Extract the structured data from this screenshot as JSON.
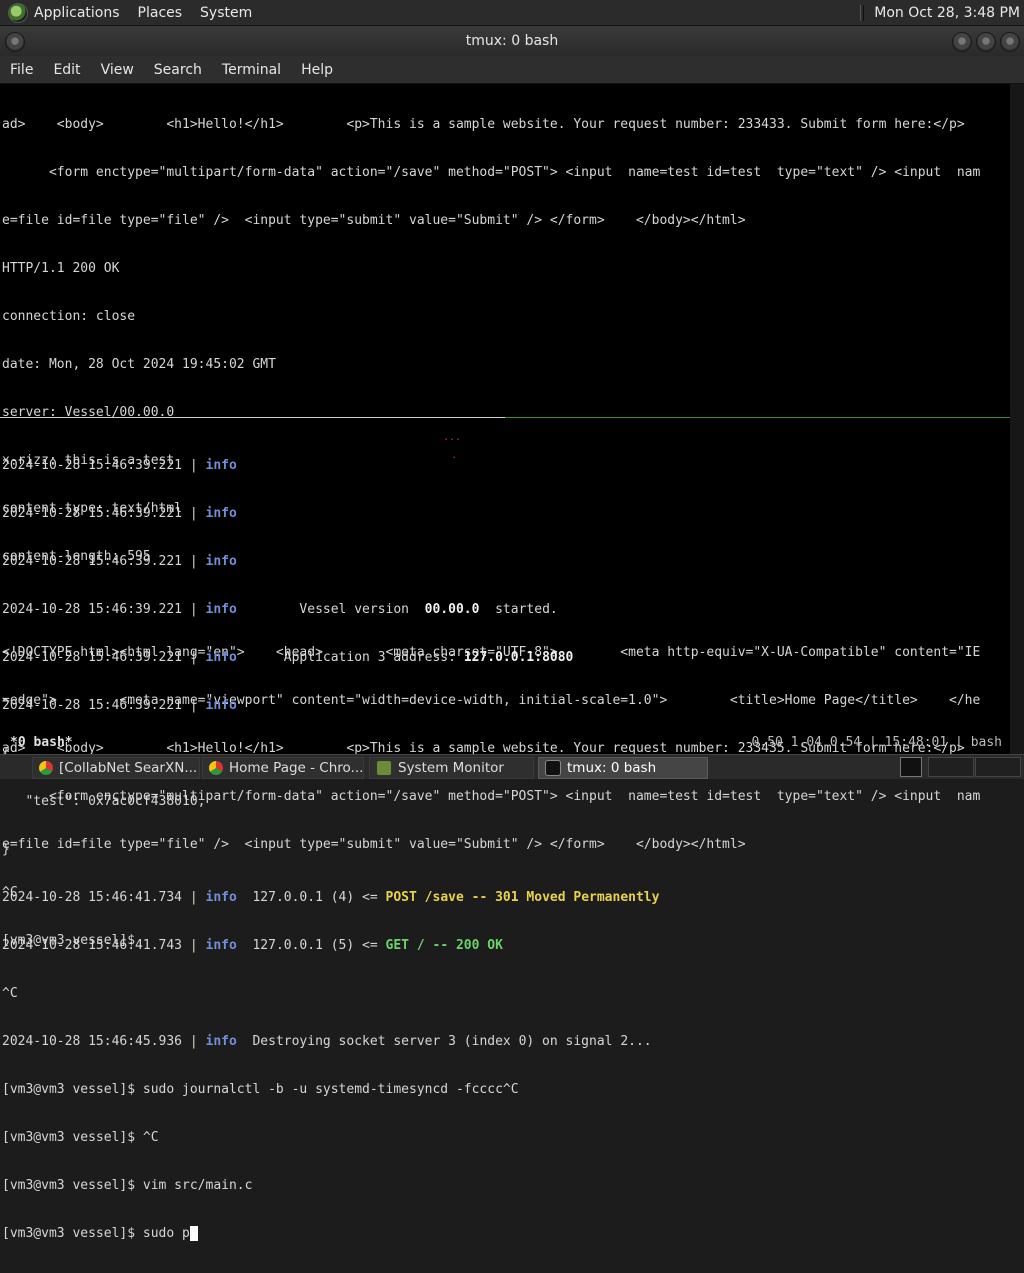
{
  "top_panel": {
    "menus": [
      "Applications",
      "Places",
      "System"
    ],
    "clock": "Mon Oct 28,  3:48 PM"
  },
  "window": {
    "title": "tmux: 0 bash"
  },
  "menubar": [
    "File",
    "Edit",
    "View",
    "Search",
    "Terminal",
    "Help"
  ],
  "terminal": {
    "top_pane": [
      "ad>    <body>        <h1>Hello!</h1>        <p>This is a sample website. Your request number: 233433. Submit form here:</p>",
      "      <form enctype=\"multipart/form-data\" action=\"/save\" method=\"POST\"> <input  name=test id=test  type=\"text\" /> <input  nam",
      "e=file id=file type=\"file\" />  <input type=\"submit\" value=\"Submit\" /> </form>    </body></html>",
      "HTTP/1.1 200 OK",
      "connection: close",
      "date: Mon, 28 Oct 2024 19:45:02 GMT",
      "server: Vessel/00.00.0",
      "x-rizz: this is a test",
      "content-type: text/html",
      "content-length: 595",
      "",
      "<!DOCTYPE html><html lang=\"en\">    <head>        <meta charset=\"UTF-8\">        <meta http-equiv=\"X-UA-Compatible\" content=\"IE",
      "=edge\">        <meta name=\"viewport\" content=\"width=device-width, initial-scale=1.0\">        <title>Home Page</title>    </he",
      "ad>    <body>        <h1>Hello!</h1>        <p>This is a sample website. Your request number: 233435. Submit form here:</p>",
      "      <form enctype=\"multipart/form-data\" action=\"/save\" method=\"POST\"> <input  name=test id=test  type=\"text\" /> <input  nam",
      "e=file id=file type=\"file\" />  <input type=\"submit\" value=\"Submit\" /> </form>    </body></html>",
      "^C",
      "[vm3@vm3 vessel]$"
    ],
    "bottom_pane": {
      "log_lines": [
        {
          "ts": "2024-10-28 15:46:39.221",
          "level": "info",
          "pre": "",
          "strong": "",
          "post": ""
        },
        {
          "ts": "2024-10-28 15:46:39.221",
          "level": "info",
          "pre": "",
          "strong": "",
          "post": ""
        },
        {
          "ts": "2024-10-28 15:46:39.221",
          "level": "info",
          "pre": "",
          "strong": "",
          "post": ""
        },
        {
          "ts": "2024-10-28 15:46:39.221",
          "level": "info",
          "pre": "        Vessel version  ",
          "strong": "00.00.0",
          "post": "  started."
        },
        {
          "ts": "2024-10-28 15:46:39.221",
          "level": "info",
          "pre": "      Application 3 address: ",
          "strong": "127.0.0.1:8080",
          "post": ""
        },
        {
          "ts": "2024-10-28 15:46:39.221",
          "level": "info",
          "pre": "",
          "strong": "",
          "post": ""
        }
      ],
      "json_lines": [
        "{",
        "   \"test\": 0x7ac0cf438010,",
        "}"
      ],
      "requests": [
        {
          "ts": "2024-10-28 15:46:41.734",
          "level": "info",
          "addr": "  127.0.0.1 (4) <= ",
          "result": "POST /save -- 301 Moved Permanently",
          "color": "yellow"
        },
        {
          "ts": "2024-10-28 15:46:41.743",
          "level": "info",
          "addr": "  127.0.0.1 (5) <= ",
          "result": "GET / -- 200 OK",
          "color": "green"
        }
      ],
      "ctrl_c": "^C",
      "shutdown": {
        "ts": "2024-10-28 15:46:45.936",
        "level": "info",
        "msg": "  Destroying socket server 3 (index 0) on signal 2..."
      },
      "shell": [
        "[vm3@vm3 vessel]$ sudo journalctl -b -u systemd-timesyncd -fcccc^C",
        "[vm3@vm3 vessel]$ ^C",
        "[vm3@vm3 vessel]$ vim src/main.c"
      ],
      "current_prompt": "[vm3@vm3 vessel]$ sudo p"
    },
    "marks": [
      "...",
      "."
    ]
  },
  "tmux_status": {
    "window": "*0 bash*",
    "right": "0.50 1.04 0.54 | 15:48:01 | bash"
  },
  "taskbar": {
    "tasks": [
      {
        "label": "[CollabNet SearXN...",
        "icon": "chrome-icon"
      },
      {
        "label": "Home Page - Chro...",
        "icon": "chrome-icon"
      },
      {
        "label": "System Monitor",
        "icon": "system-monitor-icon"
      },
      {
        "label": "tmux: 0 bash",
        "icon": "terminal-icon"
      }
    ]
  }
}
